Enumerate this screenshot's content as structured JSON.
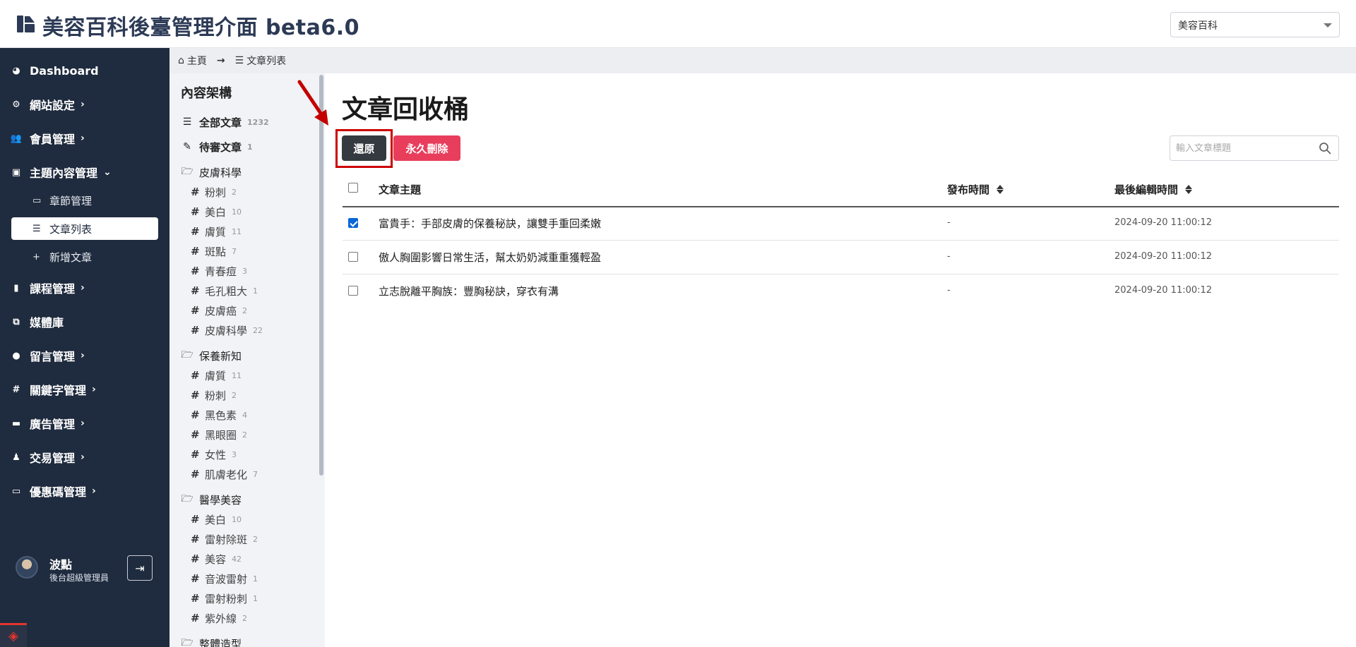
{
  "header": {
    "title": "美容百科後臺管理介面 beta6.0",
    "site_select": "美容百科"
  },
  "nav": {
    "items": [
      {
        "label": "Dashboard",
        "icon": "dashboard-icon",
        "has_children": false
      },
      {
        "label": "網站設定",
        "icon": "gear-icon",
        "has_children": true
      },
      {
        "label": "會員管理",
        "icon": "users-icon",
        "has_children": true
      },
      {
        "label": "主題內容管理",
        "icon": "content-icon",
        "has_children": true,
        "expanded": true
      },
      {
        "label": "課程管理",
        "icon": "book-icon",
        "has_children": true
      },
      {
        "label": "媒體庫",
        "icon": "images-icon",
        "has_children": false
      },
      {
        "label": "留言管理",
        "icon": "comment-icon",
        "has_children": true
      },
      {
        "label": "關鍵字管理",
        "icon": "hash-icon",
        "has_children": true
      },
      {
        "label": "廣告管理",
        "icon": "ad-icon",
        "has_children": true
      },
      {
        "label": "交易管理",
        "icon": "money-bag-icon",
        "has_children": true
      },
      {
        "label": "優惠碼管理",
        "icon": "ticket-icon",
        "has_children": true
      }
    ],
    "sub_items": [
      {
        "label": "章節管理",
        "icon": "chapter-icon"
      },
      {
        "label": "文章列表",
        "icon": "list-icon",
        "active": true
      },
      {
        "label": "新增文章",
        "icon": "plus-icon"
      }
    ],
    "user": {
      "name": "波點",
      "role": "後台超級管理員"
    }
  },
  "breadcrumb": {
    "home": "主頁",
    "current": "文章列表"
  },
  "categories": {
    "title": "內容架構",
    "all": {
      "label": "全部文章",
      "count": "1232"
    },
    "pending": {
      "label": "待審文章",
      "count": "1"
    },
    "groups": [
      {
        "name": "皮膚科學",
        "tags": [
          {
            "label": "粉刺",
            "count": "2"
          },
          {
            "label": "美白",
            "count": "10"
          },
          {
            "label": "膚質",
            "count": "11"
          },
          {
            "label": "斑點",
            "count": "7"
          },
          {
            "label": "青春痘",
            "count": "3"
          },
          {
            "label": "毛孔粗大",
            "count": "1"
          },
          {
            "label": "皮膚癌",
            "count": "2"
          },
          {
            "label": "皮膚科學",
            "count": "22"
          }
        ]
      },
      {
        "name": "保養新知",
        "tags": [
          {
            "label": "膚質",
            "count": "11"
          },
          {
            "label": "粉刺",
            "count": "2"
          },
          {
            "label": "黑色素",
            "count": "4"
          },
          {
            "label": "黑眼圈",
            "count": "2"
          },
          {
            "label": "女性",
            "count": "3"
          },
          {
            "label": "肌膚老化",
            "count": "7"
          }
        ]
      },
      {
        "name": "醫學美容",
        "tags": [
          {
            "label": "美白",
            "count": "10"
          },
          {
            "label": "雷射除斑",
            "count": "2"
          },
          {
            "label": "美容",
            "count": "42"
          },
          {
            "label": "音波雷射",
            "count": "1"
          },
          {
            "label": "雷射粉刺",
            "count": "1"
          },
          {
            "label": "紫外線",
            "count": "2"
          }
        ]
      },
      {
        "name": "整體造型",
        "tags": []
      }
    ]
  },
  "main": {
    "title": "文章回收桶",
    "restore_label": "還原",
    "delete_label": "永久刪除",
    "search_placeholder": "輸入文章標題",
    "columns": [
      "文章主題",
      "發布時間",
      "最後編輯時間"
    ],
    "rows": [
      {
        "checked": true,
        "title": "富貴手：手部皮膚的保養秘訣，讓雙手重回柔嫩",
        "published": "-",
        "edited": "2024-09-20 11:00:12"
      },
      {
        "checked": false,
        "title": "傲人胸圍影響日常生活，幫太奶奶減重重獲輕盈",
        "published": "-",
        "edited": "2024-09-20 11:00:12"
      },
      {
        "checked": false,
        "title": "立志脫離平胸族：豐胸秘訣，穿衣有溝",
        "published": "-",
        "edited": "2024-09-20 11:00:12"
      }
    ]
  }
}
